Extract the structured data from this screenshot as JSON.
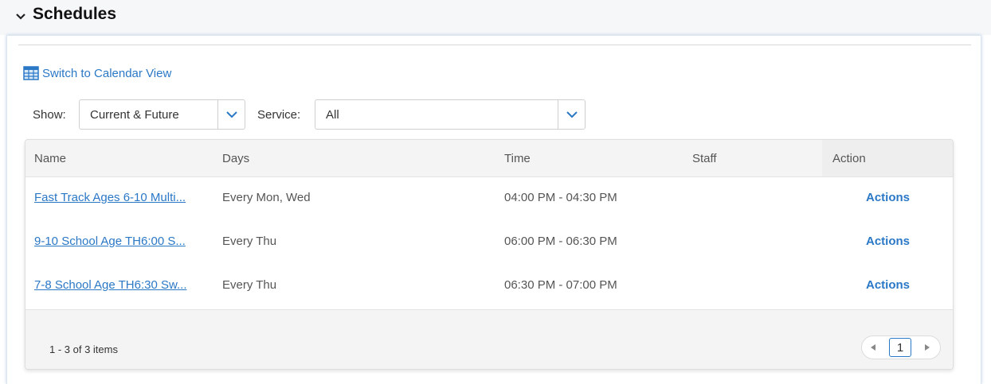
{
  "section": {
    "title": "Schedules"
  },
  "toolbar": {
    "switch_label": "Switch to Calendar View"
  },
  "filters": {
    "show_label": "Show:",
    "show_value": "Current & Future",
    "service_label": "Service:",
    "service_value": "All"
  },
  "table": {
    "columns": [
      "Name",
      "Days",
      "Time",
      "Staff",
      "Action"
    ],
    "rows": [
      {
        "name": "Fast Track Ages 6-10 Multi...",
        "days": "Every Mon, Wed",
        "time": "04:00 PM - 04:30 PM",
        "staff": "",
        "action": "Actions"
      },
      {
        "name": "9-10 School Age TH6:00 S...",
        "days": "Every Thu",
        "time": "06:00 PM - 06:30 PM",
        "staff": "",
        "action": "Actions"
      },
      {
        "name": "7-8 School Age TH6:30 Sw...",
        "days": "Every Thu",
        "time": "06:30 PM - 07:00 PM",
        "staff": "",
        "action": "Actions"
      }
    ]
  },
  "pagination": {
    "summary": "1 - 3 of 3 items",
    "current_page": "1"
  },
  "colors": {
    "link": "#2a78c6",
    "header_bg": "#f4f4f4",
    "section_bg": "#f6f7f9"
  }
}
